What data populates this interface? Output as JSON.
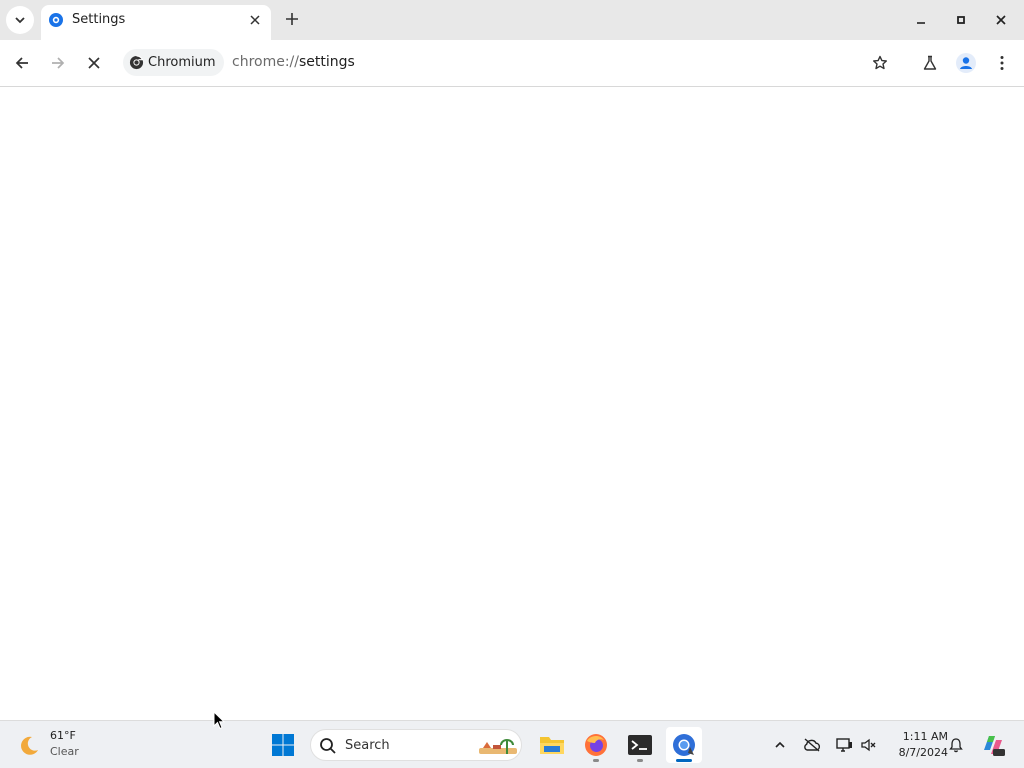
{
  "browser": {
    "tab": {
      "title": "Settings"
    },
    "omnibox": {
      "site_chip_label": "Chromium",
      "url_scheme": "chrome://",
      "url_path": "settings"
    }
  },
  "taskbar": {
    "weather": {
      "temp": "61°F",
      "condition": "Clear",
      "icon": "moon-icon"
    },
    "search_placeholder": "Search",
    "clock": {
      "time": "1:11 AM",
      "date": "8/7/2024"
    }
  },
  "colors": {
    "tabstrip_bg": "#e8e8e8",
    "accent_blue": "#1a73e8",
    "windows_blue": "#0078d4"
  }
}
